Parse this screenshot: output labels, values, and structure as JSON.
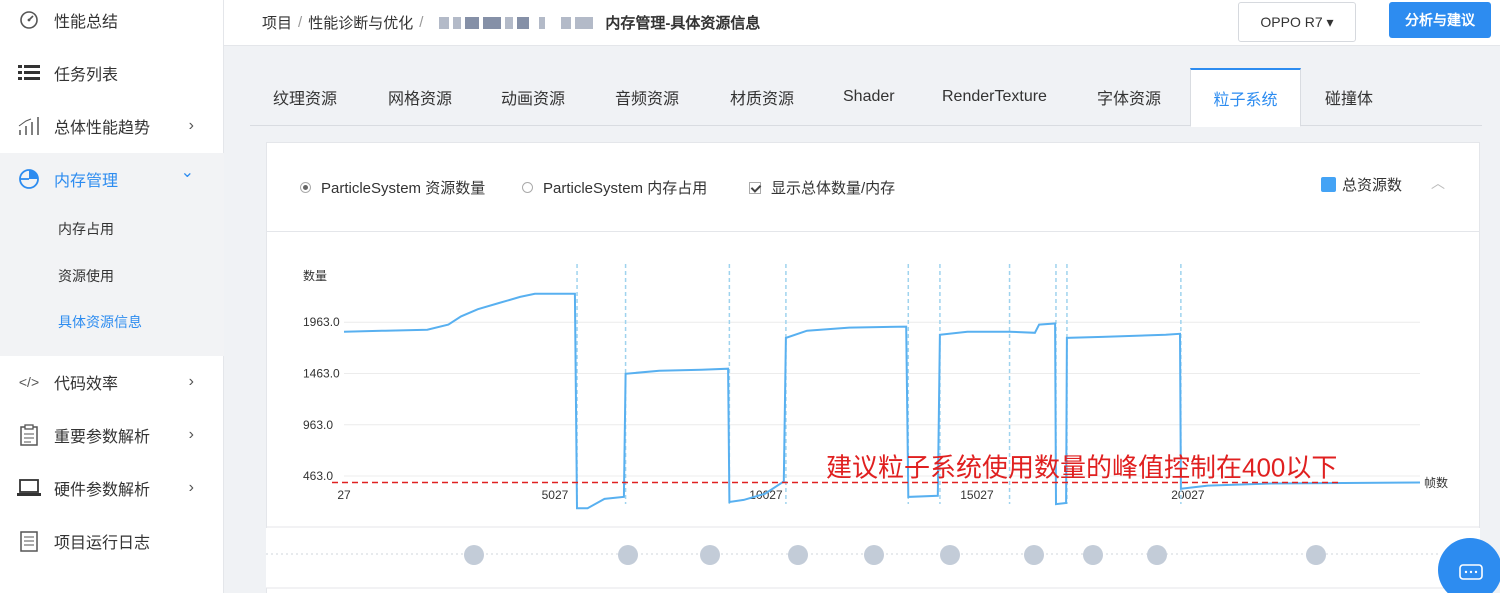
{
  "sidebar": {
    "items": [
      {
        "label": "性能总结",
        "icon": "dashboard-icon"
      },
      {
        "label": "任务列表",
        "icon": "list-icon"
      },
      {
        "label": "总体性能趋势",
        "icon": "bar-chart-icon",
        "chevron": "›"
      },
      {
        "label": "内存管理",
        "icon": "pie-chart-icon",
        "chevron": "⌄"
      },
      {
        "label": "代码效率",
        "icon": "code-icon",
        "chevron": "›"
      },
      {
        "label": "重要参数解析",
        "icon": "clipboard-icon",
        "chevron": "›"
      },
      {
        "label": "硬件参数解析",
        "icon": "laptop-icon",
        "chevron": "›"
      },
      {
        "label": "项目运行日志",
        "icon": "log-icon"
      }
    ],
    "sub_items": [
      {
        "label": "内存占用"
      },
      {
        "label": "资源使用"
      },
      {
        "label": "具体资源信息"
      }
    ]
  },
  "header": {
    "crumb_1": "项目",
    "crumb_2": "性能诊断与优化",
    "separator": "/",
    "current": "内存管理-具体资源信息",
    "device": "OPPO R7 ▾",
    "analyze_button": "分析与建议"
  },
  "tabs": [
    {
      "label": "纹理资源"
    },
    {
      "label": "网格资源"
    },
    {
      "label": "动画资源"
    },
    {
      "label": "音频资源"
    },
    {
      "label": "材质资源"
    },
    {
      "label": "Shader"
    },
    {
      "label": "RenderTexture"
    },
    {
      "label": "字体资源"
    },
    {
      "label": "粒子系统"
    },
    {
      "label": "碰撞体"
    }
  ],
  "options": {
    "radio_count": "ParticleSystem 资源数量",
    "radio_memory": "ParticleSystem 内存占用",
    "checkbox_total": "显示总体数量/内存"
  },
  "legend": {
    "label": "总资源数",
    "color": "#44a3f5"
  },
  "collapse_icon": "︿",
  "colors": {
    "accent": "#2d8cf0",
    "series": "#58b0f0",
    "threshold": "#e02020",
    "marker": "#c3ccd8"
  },
  "chart_data": {
    "type": "line",
    "ylabel": "数量",
    "xlabel": "帧数",
    "yticks": [
      463.0,
      963.0,
      1463.0,
      1963.0
    ],
    "ytick_labels": [
      "463.0",
      "963.0",
      "1463.0",
      "1963.0"
    ],
    "xticks": [
      27,
      5027,
      10027,
      15027,
      20027
    ],
    "ylim": [
      210,
      2550
    ],
    "xlim": [
      27,
      25527
    ],
    "grid": true,
    "series": [
      {
        "name": "总资源数",
        "points": [
          [
            27,
            1870
          ],
          [
            1000,
            1880
          ],
          [
            2000,
            1890
          ],
          [
            2500,
            1940
          ],
          [
            2800,
            2020
          ],
          [
            3200,
            2090
          ],
          [
            3700,
            2150
          ],
          [
            4200,
            2210
          ],
          [
            4550,
            2240
          ],
          [
            5500,
            2240
          ],
          [
            5550,
            150
          ],
          [
            5800,
            150
          ],
          [
            6200,
            240
          ],
          [
            6660,
            260
          ],
          [
            6700,
            1460
          ],
          [
            7500,
            1490
          ],
          [
            8500,
            1500
          ],
          [
            9130,
            1510
          ],
          [
            9160,
            210
          ],
          [
            9500,
            230
          ],
          [
            10000,
            290
          ],
          [
            10450,
            410
          ],
          [
            10500,
            1810
          ],
          [
            11000,
            1880
          ],
          [
            12000,
            1910
          ],
          [
            13350,
            1920
          ],
          [
            13400,
            260
          ],
          [
            14100,
            270
          ],
          [
            14150,
            1840
          ],
          [
            14800,
            1870
          ],
          [
            15800,
            1870
          ],
          [
            16400,
            1860
          ],
          [
            16500,
            1940
          ],
          [
            16880,
            1950
          ],
          [
            16900,
            190
          ],
          [
            17140,
            200
          ],
          [
            17160,
            1810
          ],
          [
            18000,
            1820
          ],
          [
            19500,
            1840
          ],
          [
            19840,
            1850
          ],
          [
            19860,
            340
          ],
          [
            20500,
            370
          ],
          [
            22000,
            390
          ],
          [
            25527,
            400
          ]
        ]
      }
    ],
    "frame_markers": [
      5550,
      6700,
      9160,
      10500,
      13400,
      14150,
      15800,
      16900,
      17160,
      19860
    ],
    "annotation": {
      "text": "建议粒子系统使用数量的峰值控制在400以下",
      "threshold": 400
    }
  }
}
